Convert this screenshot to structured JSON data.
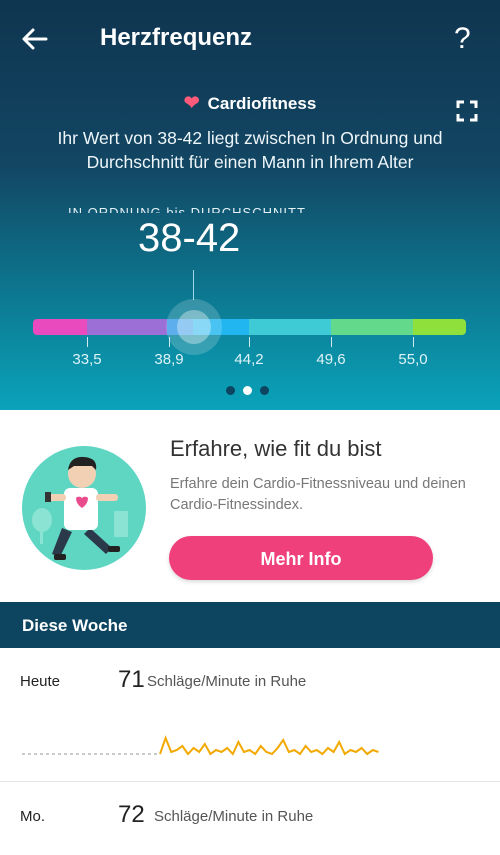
{
  "header": {
    "title": "Herzfrequenz",
    "help": "?"
  },
  "cardio": {
    "label": "Cardiofitness",
    "description": "Ihr Wert von 38-42 liegt zwischen In Ordnung und Durchschnitt für einen Mann in Ihrem Alter",
    "range_label": "IN ORDNUNG bis DURCHSCHNITT",
    "value": "38-42",
    "scale_ticks": [
      "33,5",
      "38,9",
      "44,2",
      "49,6",
      "55,0"
    ],
    "scale_colors": [
      "#e94bbf",
      "#9b6fd6",
      "#3a9de8",
      "#22b6f0",
      "#3fcbd6",
      "#63d98c",
      "#8fe03a"
    ],
    "pager_active_index": 1
  },
  "promo": {
    "title": "Erfahre, wie fit du bist",
    "text": "Erfahre dein Cardio-Fitnessniveau und deinen Cardio-Fitnessindex.",
    "button": "Mehr Info"
  },
  "week": {
    "header": "Diese Woche",
    "rows": [
      {
        "day": "Heute",
        "value": "71",
        "unit": "Schläge/Minute in Ruhe"
      },
      {
        "day": "Mo.",
        "value": "72",
        "unit": "Schläge/Minute in Ruhe"
      }
    ]
  },
  "colors": {
    "accent": "#f0407c",
    "header_bg": "#0d4560",
    "spark": "#f2a900"
  }
}
